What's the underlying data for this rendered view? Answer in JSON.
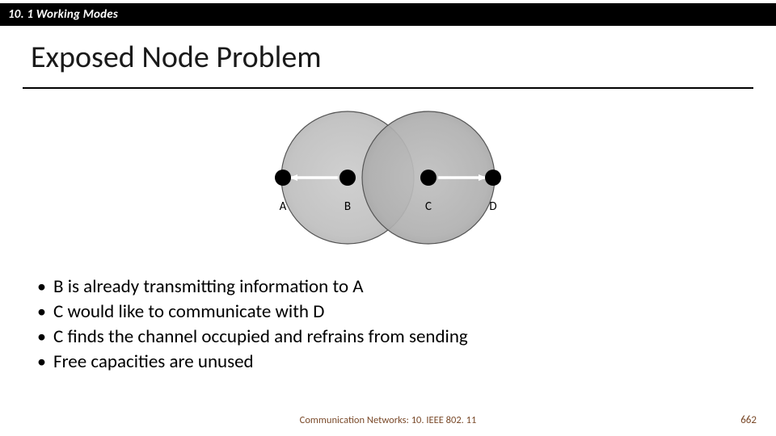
{
  "section": "10. 1 Working Modes",
  "title": "Exposed Node Problem",
  "nodes": {
    "a": "A",
    "b": "B",
    "c": "C",
    "d": "D"
  },
  "bullets": [
    "B is already transmitting information to A",
    "C would like to communicate with D",
    "C  finds the channel occupied and refrains from sending",
    "Free capacities are unused"
  ],
  "footer": {
    "center": "Communication Networks: 10. IEEE 802. 11",
    "page": "662"
  }
}
